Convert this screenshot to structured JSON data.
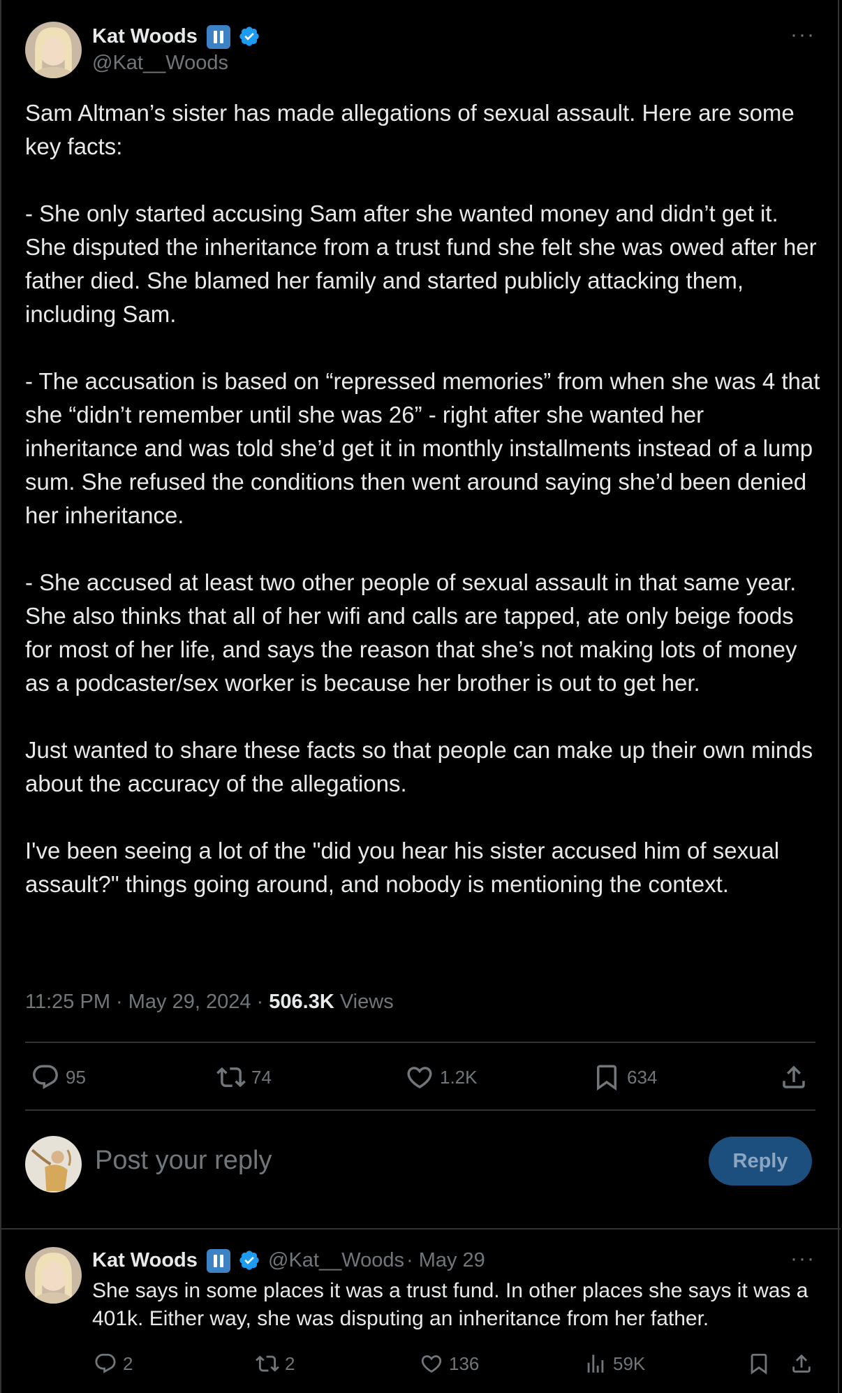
{
  "post": {
    "author": {
      "name": "Kat Woods",
      "handle": "@Kat__Woods"
    },
    "text": "Sam Altman’s sister has made allegations of sexual assault. Here are some key facts:\n\n- She only started accusing Sam after she wanted money and didn’t get it. She disputed the inheritance from a trust fund she felt she was owed after her father died. She blamed her family and started publicly attacking them, including Sam.\n\n- The accusation is based on “repressed memories” from when she was 4 that she “didn’t remember until she was 26” - right after she wanted her inheritance and was told she’d get it in monthly installments instead of a lump sum. She refused the conditions then went around saying she’d been denied her inheritance.\n\n- She accused at least two other people of sexual assault in that same year. She also thinks that all of her wifi and calls are tapped, ate only beige foods for most of her life, and says the reason that she’s not making lots of money as a podcaster/sex worker is because her brother is out to get her.\n\nJust wanted to share these facts so that people can make up their own minds about the accuracy of the allegations.\n\nI've been seeing a lot of the \"did you hear his sister accused him of sexual assault?\" things going around, and nobody is mentioning the context.",
    "time": "11:25 PM",
    "date": "May 29, 2024",
    "separator": " · ",
    "views_count": "506.3K",
    "views_label": "Views",
    "more_icon": "···",
    "actions": {
      "replies": "95",
      "reposts": "74",
      "likes": "1.2K",
      "bookmarks": "634"
    }
  },
  "composer": {
    "placeholder": "Post your reply",
    "button_label": "Reply"
  },
  "reply": {
    "author": {
      "name": "Kat Woods",
      "handle": "@Kat__Woods"
    },
    "date": "· May 29",
    "text": "She says in some places it was a trust fund. In other places she says it was a 401k. Either way, she was disputing an inheritance from her father.",
    "more_icon": "···",
    "actions": {
      "replies": "2",
      "reposts": "2",
      "likes": "136",
      "views": "59K"
    }
  },
  "colors": {
    "background": "#000000",
    "text": "#e7e9ea",
    "secondary": "#71767b",
    "verified": "#1d9bf0",
    "divider": "#2f3336",
    "reply_button": "#1d4f7e"
  }
}
